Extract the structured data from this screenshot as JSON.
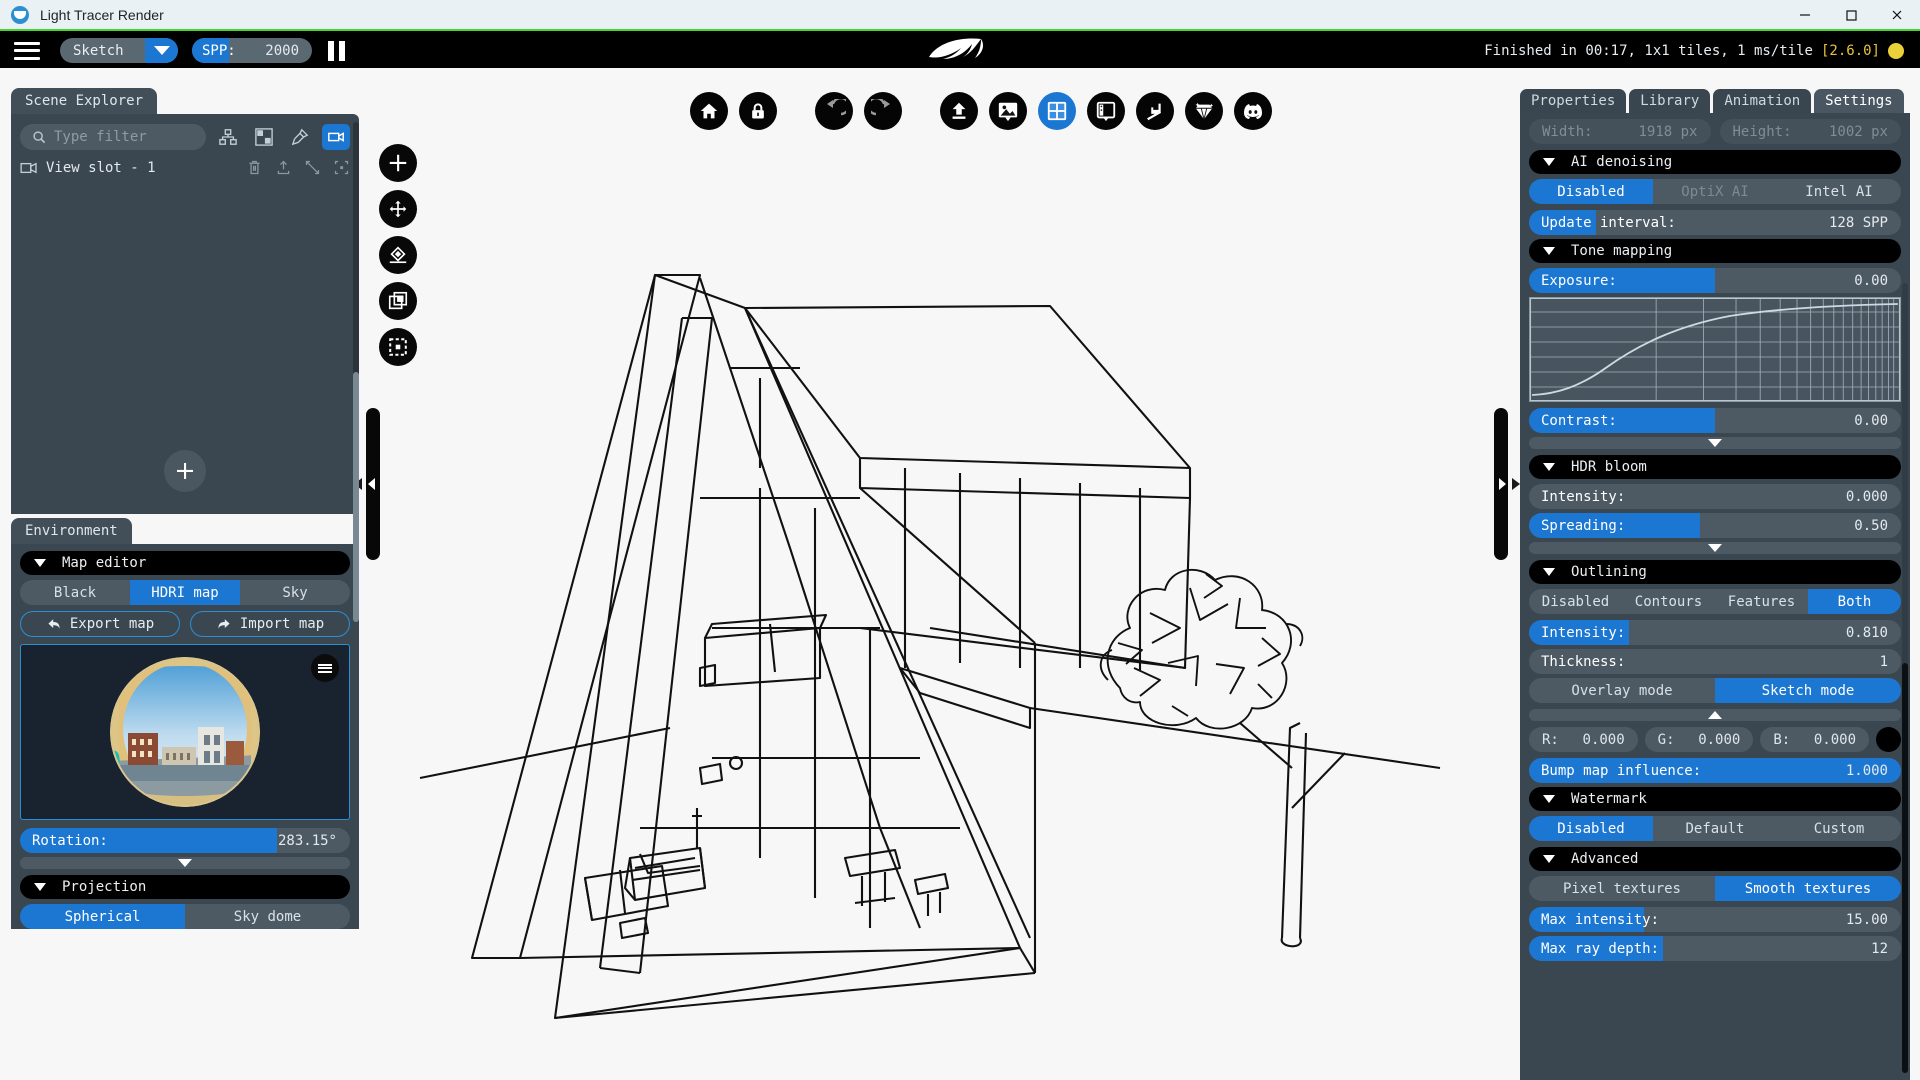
{
  "window": {
    "title": "Light Tracer Render",
    "minimize": "minimize-button",
    "maximize": "maximize-button",
    "close": "close-button"
  },
  "toolbar": {
    "menu_label": "menu",
    "mode": {
      "value": "Sketch"
    },
    "spp": {
      "label": "SPP:",
      "value": "2000",
      "fill_percent": 31
    },
    "pause_label": "pause",
    "status": {
      "text": "Finished in 00:17, 1x1 tiles, 1 ms/tile",
      "version": "[2.6.0]"
    }
  },
  "center_toolbar": {
    "icons": [
      {
        "name": "home-icon",
        "active": false
      },
      {
        "name": "lock-icon",
        "active": false
      },
      {
        "name": "undo-icon",
        "active": false
      },
      {
        "name": "redo-icon",
        "active": false
      },
      {
        "name": "upload-icon",
        "active": false
      },
      {
        "name": "image-export-icon",
        "active": false
      },
      {
        "name": "grid-view-icon",
        "active": true
      },
      {
        "name": "panel-layout-icon",
        "active": false
      },
      {
        "name": "snap-icon",
        "active": false
      },
      {
        "name": "gem-material-icon",
        "active": false
      },
      {
        "name": "discord-icon",
        "active": false
      }
    ]
  },
  "left_toolbar": {
    "icons": [
      {
        "name": "add-object-icon"
      },
      {
        "name": "move-tool-icon"
      },
      {
        "name": "drop-to-floor-icon"
      },
      {
        "name": "duplicate-icon"
      },
      {
        "name": "select-region-icon"
      }
    ]
  },
  "scene_explorer": {
    "tab": "Scene Explorer",
    "filter_placeholder": "Type filter",
    "view_buttons": [
      {
        "name": "hierarchy-view-icon",
        "selected": false
      },
      {
        "name": "grid-view-icon",
        "selected": false
      },
      {
        "name": "pin-icon",
        "selected": false
      },
      {
        "name": "camera-view-icon",
        "selected": true
      }
    ],
    "slot": {
      "label": "View slot - 1",
      "tools": [
        "delete-icon",
        "export-icon",
        "fit-icon",
        "isolate-icon"
      ]
    },
    "add_button": "add-scene-item-button"
  },
  "environment": {
    "tab": "Environment",
    "map_editor": {
      "title": "Map editor",
      "modes": [
        {
          "label": "Black",
          "on": false
        },
        {
          "label": "HDRI map",
          "on": true
        },
        {
          "label": "Sky",
          "on": false
        }
      ],
      "export_label": "Export map",
      "import_label": "Import map",
      "preview_menu": "hdri-options-button"
    },
    "rotation": {
      "label": "Rotation:",
      "value": "283.15°",
      "fill_percent": 78
    },
    "projection": {
      "title": "Projection",
      "modes": [
        {
          "label": "Spherical",
          "on": true
        },
        {
          "label": "Sky dome",
          "on": false
        }
      ]
    }
  },
  "properties_panel": {
    "tabs": [
      {
        "label": "Properties",
        "on": false
      },
      {
        "label": "Library",
        "on": false
      },
      {
        "label": "Animation",
        "on": false
      },
      {
        "label": "Settings",
        "on": true
      }
    ],
    "resolution": {
      "width_label": "Width:",
      "width_value": "1918 px",
      "height_label": "Height:",
      "height_value": "1002 px"
    },
    "ai_denoising": {
      "title": "AI denoising",
      "modes": [
        {
          "label": "Disabled",
          "on": true,
          "dim": false
        },
        {
          "label": "OptiX AI",
          "on": false,
          "dim": true
        },
        {
          "label": "Intel AI",
          "on": false,
          "dim": false
        }
      ],
      "update_interval": {
        "label": "Update interval:",
        "value": "128 SPP",
        "fill_percent": 18
      }
    },
    "tone_mapping": {
      "title": "Tone mapping",
      "exposure": {
        "label": "Exposure:",
        "value": "0.00",
        "fill_percent": 50
      },
      "contrast": {
        "label": "Contrast:",
        "value": "0.00",
        "fill_percent": 50
      }
    },
    "hdr_bloom": {
      "title": "HDR bloom",
      "intensity": {
        "label": "Intensity:",
        "value": "0.000",
        "fill_percent": 0
      },
      "spreading": {
        "label": "Spreading:",
        "value": "0.50",
        "fill_percent": 50
      }
    },
    "outlining": {
      "title": "Outlining",
      "modes": [
        {
          "label": "Disabled",
          "on": false
        },
        {
          "label": "Contours",
          "on": false
        },
        {
          "label": "Features",
          "on": false
        },
        {
          "label": "Both",
          "on": true
        }
      ],
      "intensity": {
        "label": "Intensity:",
        "value": "0.810",
        "fill_percent": 27
      },
      "thickness": {
        "label": "Thickness:",
        "value": "1",
        "fill_percent": 0
      },
      "render_modes": [
        {
          "label": "Overlay mode",
          "on": false
        },
        {
          "label": "Sketch mode",
          "on": true
        }
      ],
      "color": {
        "r_label": "R:",
        "r_value": "0.000",
        "g_label": "G:",
        "g_value": "0.000",
        "b_label": "B:",
        "b_value": "0.000",
        "hex": "#000000"
      },
      "bump_map": {
        "label": "Bump map influence:",
        "value": "1.000",
        "fill_percent": 100
      }
    },
    "watermark": {
      "title": "Watermark",
      "modes": [
        {
          "label": "Disabled",
          "on": true
        },
        {
          "label": "Default",
          "on": false
        },
        {
          "label": "Custom",
          "on": false
        }
      ]
    },
    "advanced": {
      "title": "Advanced",
      "texture_modes": [
        {
          "label": "Pixel textures",
          "on": false
        },
        {
          "label": "Smooth textures",
          "on": true
        }
      ],
      "max_intensity": {
        "label": "Max intensity:",
        "value": "15.00",
        "fill_percent": 31
      },
      "max_ray_depth": {
        "label": "Max ray depth:",
        "value": "12",
        "fill_percent": 36
      }
    }
  },
  "colors": {
    "accent": "#1b77d2",
    "panel": "#3b4750",
    "control": "#4d5a64",
    "titlebar": "#eaf1f4",
    "green_rule": "#44d62c",
    "status_version": "#e8c33a"
  },
  "viewport": {
    "content_name": "a-frame-house-line-drawing"
  }
}
